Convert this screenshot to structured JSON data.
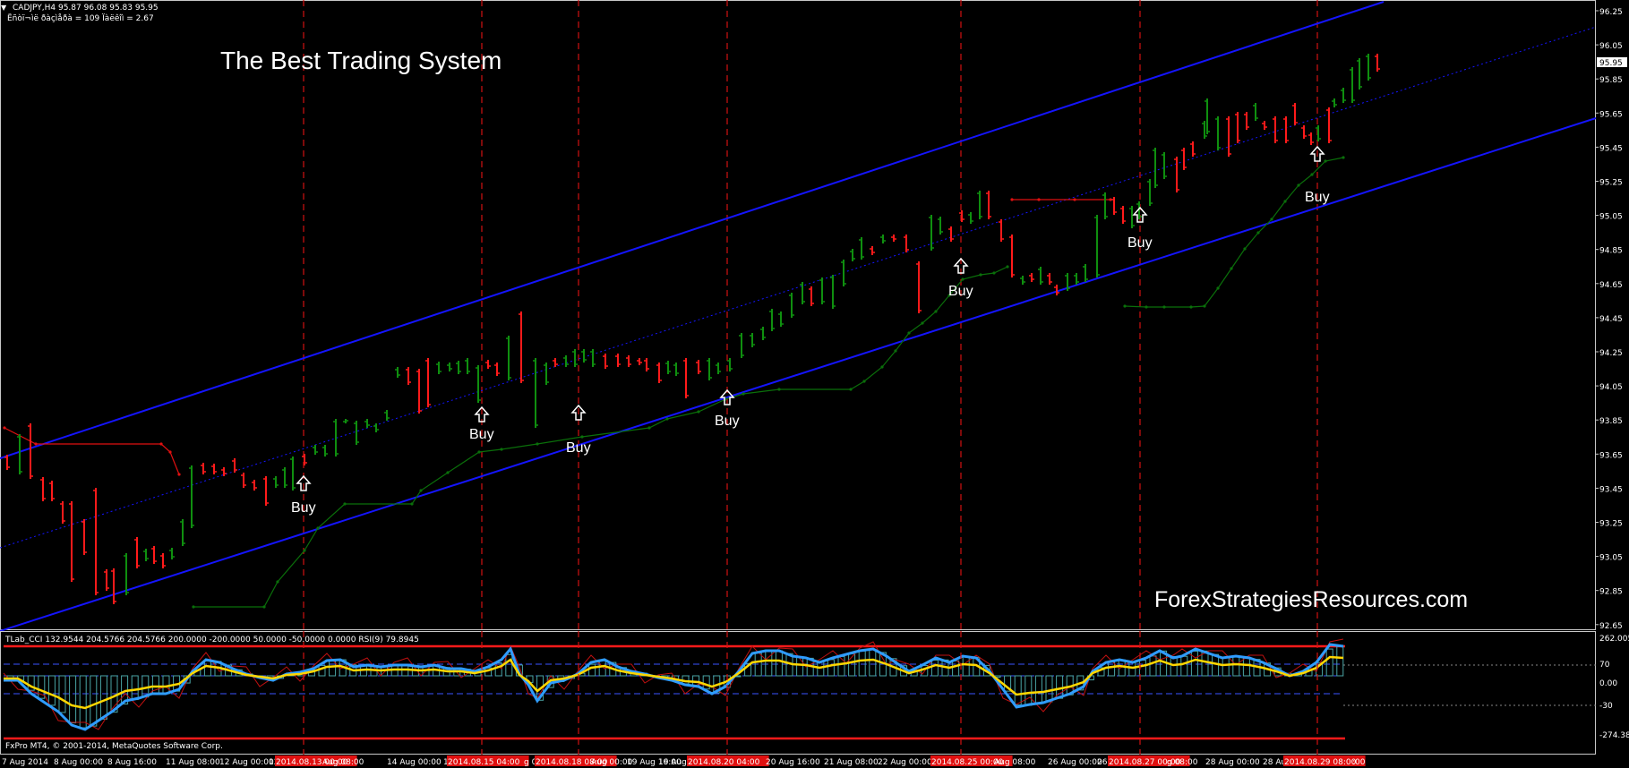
{
  "header": {
    "symbol_line": "CADJPY,H4  95.87 96.08 95.83 95.95",
    "info_line": "Ëñòï¬ìë ðàçìåðà = 109 Ïàëêîì = 2.67"
  },
  "overlay": {
    "title": "The Best Trading System",
    "site": "ForexStrategiesResources.com"
  },
  "indicator": {
    "header": "TLab_CCI 132.9544 204.5766 204.5766 200.0000 -200.0000 50.0000 -50.0000 0.0000  RSI(9) 79.8945",
    "copyright": "FxPro MT4, © 2001-2014, MetaQuotes Software Corp.",
    "scale_labels": [
      "262.0058",
      "70",
      "0.00",
      "-30",
      "-274.381"
    ]
  },
  "price_axis": {
    "labels": [
      "96.25",
      "96.05",
      "95.85",
      "95.65",
      "95.45",
      "95.25",
      "95.05",
      "94.85",
      "94.65",
      "94.45",
      "94.25",
      "94.05",
      "93.85",
      "93.65",
      "93.45",
      "93.25",
      "93.05",
      "92.85",
      "92.65"
    ],
    "current_price": "95.95"
  },
  "time_axis": {
    "labels": [
      "7 Aug 2014",
      "8 Aug 00:00",
      "8 Aug 16:00",
      "11 Aug 08:00",
      "12 Aug 00:00",
      "12 Aug 16:00",
      "2014.08.13 00:00",
      "Aug 08:00",
      "14 Aug 00:00",
      "14",
      "2014.08.15 04:00",
      "g 08:00",
      "2014.08.18 08:00",
      "Aug 00:00",
      "19 Aug 16:00",
      "19 Aug 0",
      "2014.08.20 04:00",
      "20 Aug 16:00",
      "21 Aug 08:00",
      "22 Aug 00:00",
      "2014.08.25 00:00",
      "Aug 08:00",
      "26 Aug 00:00",
      "26",
      "2014.08.27 00:00",
      "g 08:00",
      "28 Aug 00:00",
      "28 Aug",
      "2014.08.29 08:00",
      ":00"
    ],
    "highlight_indices": [
      6,
      10,
      12,
      16,
      20,
      24,
      28
    ]
  },
  "signals": {
    "label": "Buy",
    "arrow_icon": "up-arrow-icon"
  },
  "colors": {
    "channel": "#1414ff",
    "bull": "#0f8f0f",
    "bear": "#ff1a1a",
    "vline": "#d01010",
    "trail_green": "#0a6f0a",
    "trail_red": "#e01010",
    "cci": "#2f9cff",
    "rsi": "#ffd700",
    "hist": "#4aa5a5"
  }
}
